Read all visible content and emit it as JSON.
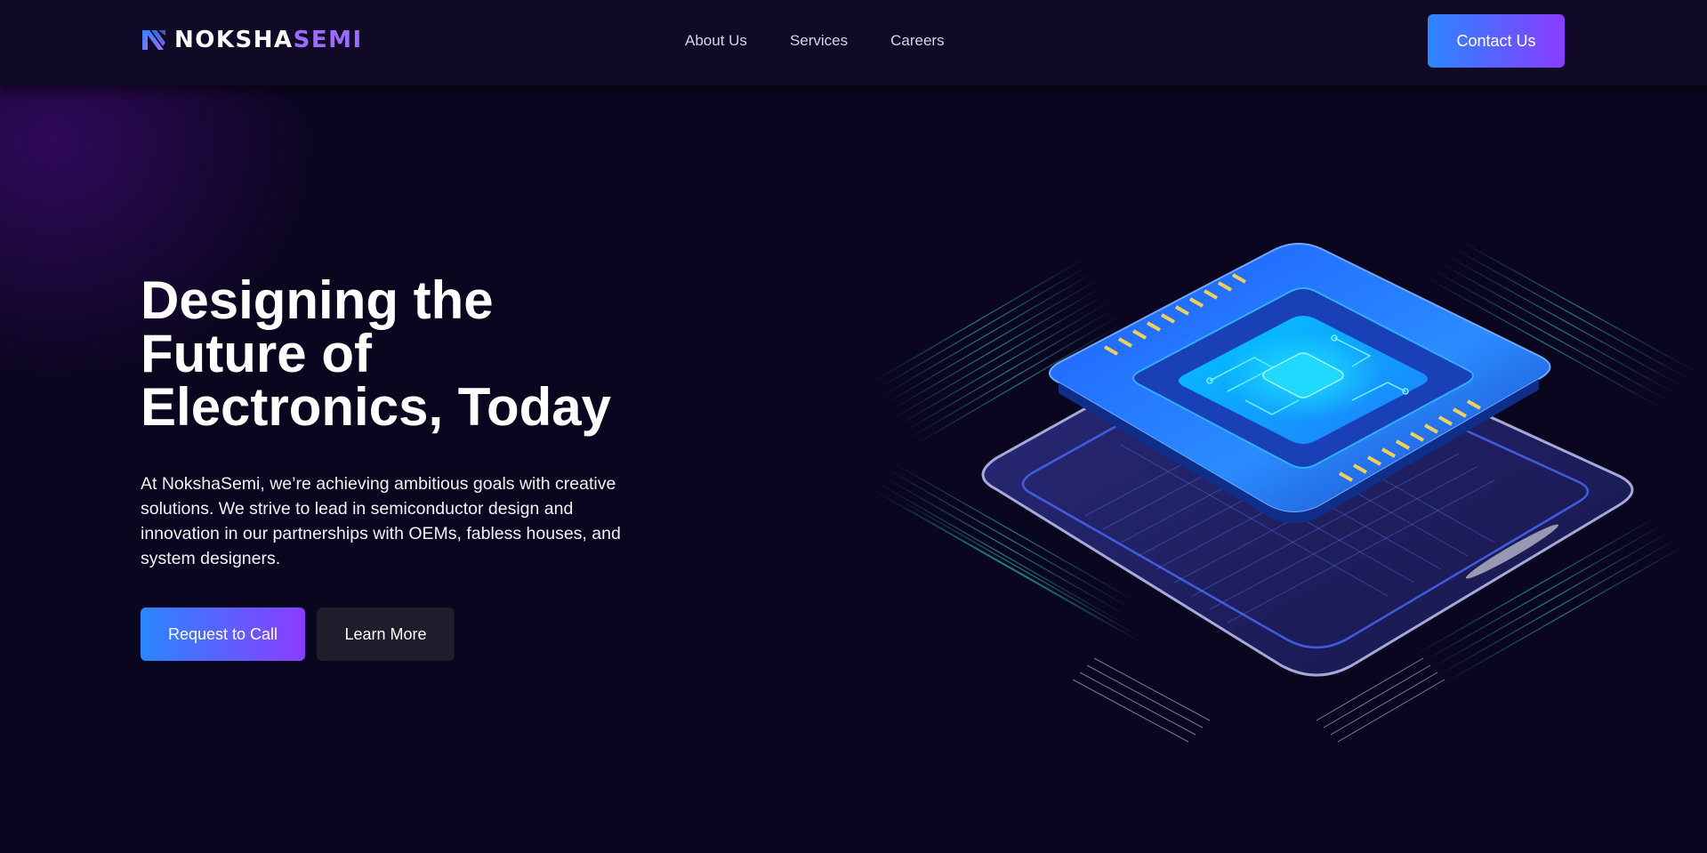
{
  "brand": {
    "logo_part1": "NOKSHA",
    "logo_part2": "SEMI",
    "logo_icon": "n-logo-icon",
    "accent_color": "#9b6cff"
  },
  "nav": {
    "links": [
      {
        "label": "About Us"
      },
      {
        "label": "Services"
      },
      {
        "label": "Careers"
      }
    ],
    "contact_label": "Contact Us"
  },
  "hero": {
    "title_lines": [
      "Designing the",
      "Future of",
      "Electronics, Today"
    ],
    "description": "At NokshaSemi, we’re achieving ambitious goals with creative solutions. We strive to lead in semiconductor design and innovation in our partnerships with OEMs, fabless houses, and system designers.",
    "primary_button": "Request to Call",
    "secondary_button": "Learn More",
    "illustration": "semiconductor-chip-illustration"
  },
  "colors": {
    "background": "#0b0620",
    "nav_background": "#100a26",
    "gradient_start": "#2b86ff",
    "gradient_end": "#8a3dff",
    "secondary_button": "#1d1d2b"
  }
}
